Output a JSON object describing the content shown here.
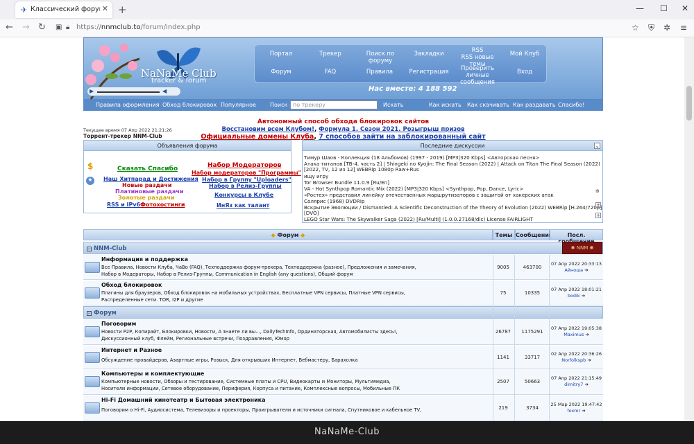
{
  "browser": {
    "tab_title": "Классический форум-трекер",
    "url_prefix": "https://",
    "url_host": "nnmclub.to",
    "url_path": "/forum/index.php"
  },
  "header": {
    "logo_title": "NaNaMe Club",
    "logo_subtitle": "tracker & forum",
    "online": "Нас вместе: 4 188 592",
    "menu": [
      "Портал",
      "Трекер",
      "Поиск по форуму",
      "Закладки",
      "RSS",
      "RSS новые темы",
      "Мой Клуб",
      "Форум",
      "FAQ",
      "Правила",
      "Регистрация",
      "Проверить личные сообщения",
      "Вход"
    ]
  },
  "subnav": {
    "items": [
      "Правила оформления",
      "Обход блокировок",
      "Популярное"
    ],
    "search_label": "Поиск :",
    "search_placeholder": "по трекеру",
    "search_button": "Искать",
    "right_items": [
      "Как искать",
      "Как скачивать",
      "Как раздавать",
      "Спасибо!"
    ]
  },
  "promo": {
    "line1": "Автономный способ обхода блокировок сайтов",
    "line2a": "Восстановим всем Клубом!",
    "line2b": "Формула 1. Сезон 2021. Розыгрыш призов",
    "line3a": "Официальные домены Клуба",
    "line3b": "7 способов зайти на заблокированный сайт"
  },
  "time": "Текущее время 07 Апр 2022 21:21:26",
  "site_name": "Торрент-трекер NNM-Club",
  "announcements": {
    "title": "Объявления форума",
    "items": [
      "Сказать Спасибо",
      "Набор Модераторов",
      "Набор модераторов \"Программы\"",
      "Наш Хитпарад и Достижения",
      "Набор в Группу \"Uploaders\"",
      "Новые раздачи",
      "Набор в Релиз-Группы",
      "Платиновые раздачи",
      "Конкурсы в Клубе",
      "Золотые раздачи",
      "RSS и IPv6",
      "Фотохостинги",
      "ИнЯз как талант"
    ]
  },
  "discussions": {
    "title": "Последние дискуссии",
    "items": [
      "Тимур Шаов - Коллекция (18 Альбомов) (1997 - 2019) [MP3|320 Kbps] <Авторская песня>",
      "Атака титанов [ТВ-4, часть 2] | Shingeki no Kyojin: The Final Season (2022) | Attack on Titan The Final Season (2022)",
      "[2022, TV, 12 из 12] WEBRip 1080p Raw+Rus",
      "ищу игру",
      "Tor Browser Bundle 11.0.9 [Ru/En]",
      "VA - Hot Synthpop Romantic Mix (2022) [MP3|320 Kbps] <Synthpop, Pop, Dance, Lyric>",
      "«Ростех» представил линейку отечественных маршрутизаторов с защитой от хакерских атак",
      "Солярис (1968) DVDRip",
      "Вскрытие Эволюции / Dismantled: A Scientific Deconstruction of the Theory of Evolution (2022) WEBRip [H.264/720p]",
      "[DVO]",
      "LEGO Star Wars: The Skywalker Saga (2022) [Ru/Multi] (1.0.0.27168/dlc) License FAIRLIGHT"
    ]
  },
  "forum": {
    "col_forum": "Форум",
    "col_topics": "Темы",
    "col_posts": "Сообщений",
    "col_last": "Посл. сообщение",
    "cat1": "NNM-Club",
    "cat2": "Форум",
    "rows": [
      {
        "name": "Информация и поддержка",
        "subs1": "Все Правила, Новости Клуба, ЧаВо (FAQ), Техподдержка форум-трекера, Техподдержка (разное), Предложения и замечания,",
        "subs2": "Набор в Модераторы, Набор в Релиз-Группы, Communication in English (any questions), Общий форум",
        "topics": "9005",
        "posts": "463700",
        "last_date": "07 Апр 2022 20:33:13",
        "last_user": "Айноша"
      },
      {
        "name": "Обход блокировок",
        "subs1": "Плагины для браузеров, Обход блокировок на мобильных устройствах, Бесплатные VPN сервисы, Платные VPN сервисы,",
        "subs2": "Распределенные сети. TOR, I2P и другие",
        "topics": "75",
        "posts": "10335",
        "last_date": "07 Апр 2022 18:01:21",
        "last_user": "bodik"
      },
      {
        "name": "Поговорим",
        "subs1": "Новости P2P, Копирайт, Блокировки, Новости, А знаете ли вы..., DailyTechInfo, Ординаторская, Автомобилисты здесь!,",
        "subs2": "Дискуссионный клуб, Флейм, Региональные встречи, Поздравления, Юмор",
        "topics": "26787",
        "posts": "1175291",
        "last_date": "07 Апр 2022 19:05:38",
        "last_user": "Maximus"
      },
      {
        "name": "Интернет и Разное",
        "subs1": "Обсуждение провайдеров, Азартные игры, Розыск, Для открывших Интернет, Вебмастеру, Барахолка",
        "subs2": "",
        "topics": "1141",
        "posts": "33717",
        "last_date": "02 Апр 2022 20:36:26",
        "last_user": "Norfolkspb"
      },
      {
        "name": "Компьютеры и комплектующие",
        "subs1": "Компьютерные новости, Обзоры и тестирование, Системные платы и CPU, Видеокарты и Мониторы, Мультимедиа,",
        "subs2": "Носители информации, Сетевое оборудование, Периферия, Корпуса и питание, Комплексные вопросы, Мобильные ПК",
        "topics": "2507",
        "posts": "50663",
        "last_date": "07 Апр 2022 21:15:49",
        "last_user": "dimitry7"
      },
      {
        "name": "Hi-Fi Домашний кинотеатр и Бытовая электроника",
        "subs1": "Поговорим о Hi-Fi, Аудиосистема, Телевизоры и проекторы, Проигрыватели и источники сигнала, Спутниковое и кабельное TV,",
        "subs2": "",
        "topics": "219",
        "posts": "3734",
        "last_date": "25 Мар 2022 19:47:42",
        "last_user": "foxmr"
      }
    ]
  },
  "footer_watermark": "NaNaMe-Club"
}
